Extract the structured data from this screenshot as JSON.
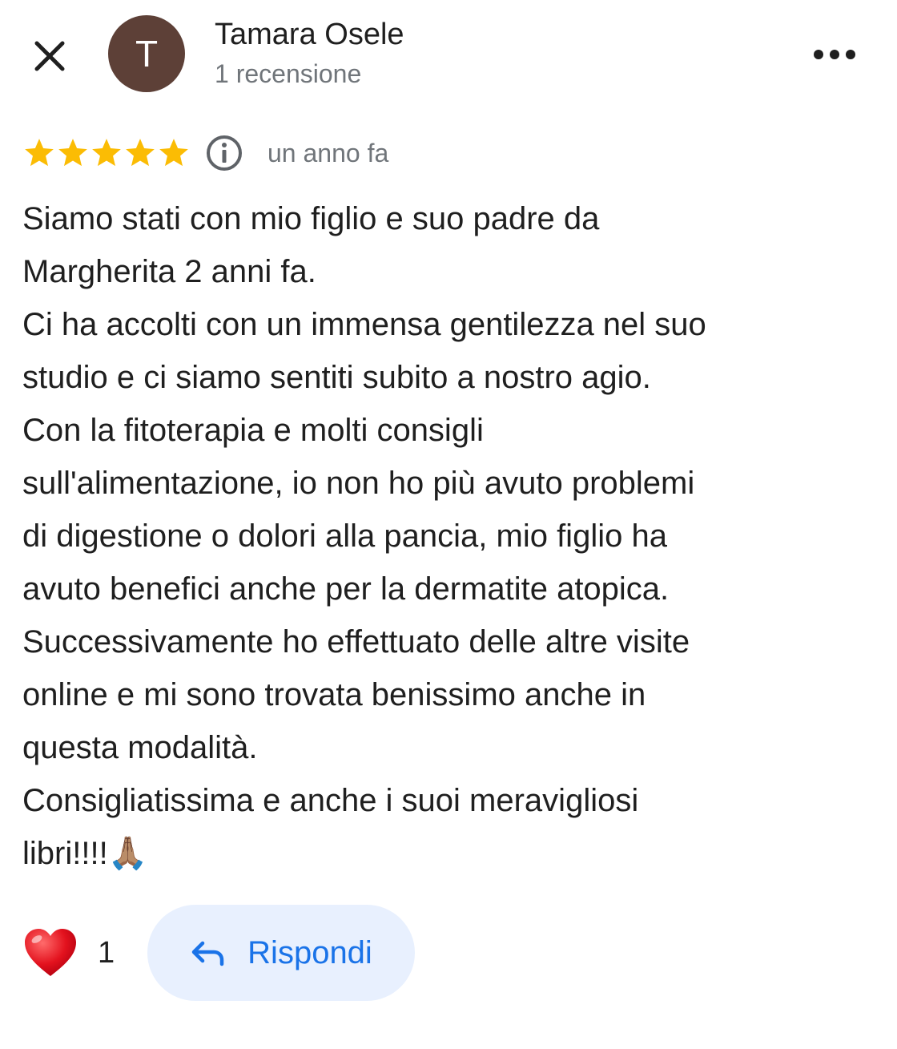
{
  "header": {
    "close_icon": "close-icon",
    "avatar_initial": "T",
    "avatar_color": "#5d4037",
    "author_name": "Tamara Osele",
    "author_meta": "1 recensione",
    "more_icon": "more-horizontal-icon"
  },
  "review": {
    "rating": 5,
    "rating_max": 5,
    "star_color": "#fbbc04",
    "info_icon": "info-icon",
    "date": "un anno fa",
    "text": "Siamo stati con mio figlio e suo padre da\nMargherita 2 anni fa.\nCi ha accolti con un immensa gentilezza nel suo\nstudio e ci siamo sentiti subito a nostro agio.\nCon la fitoterapia e molti consigli\nsull'alimentazione, io non ho più avuto problemi\ndi digestione o dolori alla pancia, mio figlio ha\navuto benefici anche per la dermatite atopica.\nSuccessivamente ho effettuato delle altre visite\nonline e mi sono trovata benissimo anche in\nquesta modalità.\nConsigliatissima e anche i suoi meravigliosi\nlibri!!!!🙏🏽"
  },
  "actions": {
    "like_icon": "heart-icon",
    "like_count": "1",
    "reply_icon": "reply-arrow-icon",
    "reply_label": "Rispondi",
    "accent_color": "#1a73e8",
    "reply_bg": "#e8f0fe"
  }
}
